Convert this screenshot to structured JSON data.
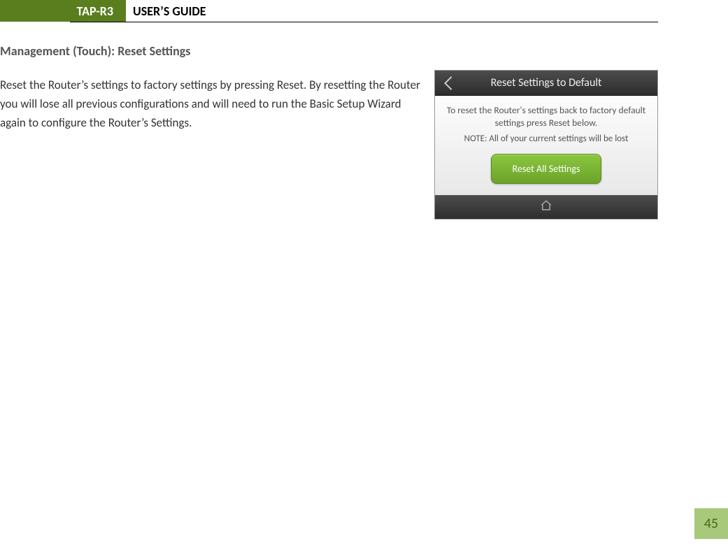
{
  "header": {
    "tab": "TAP-R3",
    "title": "USER’S GUIDE"
  },
  "section": {
    "heading": "Management (Touch): Reset Settings",
    "body": "Reset the Router’s settings to factory settings by pressing Reset.  By resetting the Router you will lose all previous configurations and will need to run the Basic Setup Wizard again to configure the Router’s Settings."
  },
  "phone": {
    "header_title": "Reset Settings to Default",
    "instruction": "To reset the Router's settings back to factory default settings press Reset below.",
    "note": "NOTE: All of your current settings will be lost",
    "button_label": "Reset All Settings"
  },
  "page_number": "45"
}
